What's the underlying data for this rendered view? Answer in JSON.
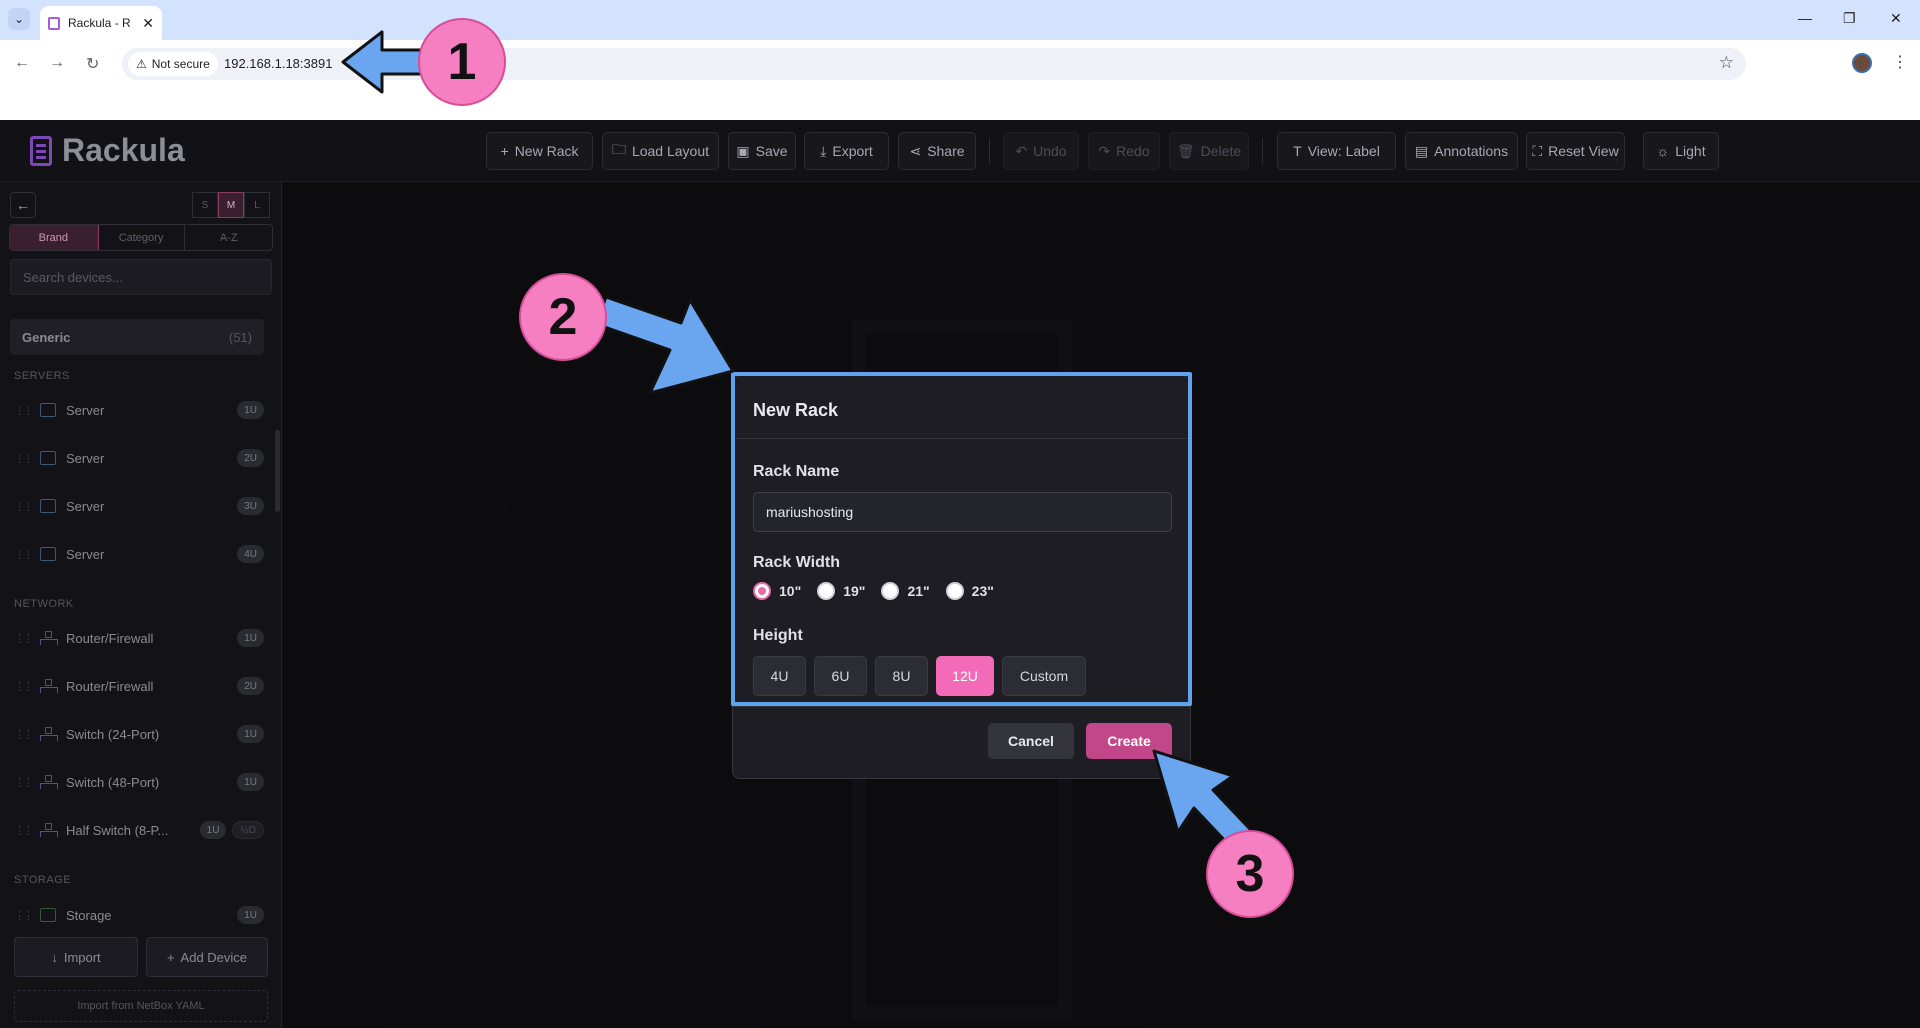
{
  "browser": {
    "tab_title": "Rackula - R",
    "security_label": "Not secure",
    "url": "192.168.1.18:3891"
  },
  "app": {
    "name": "Rackula",
    "toolbar": {
      "new_rack": "New Rack",
      "load_layout": "Load Layout",
      "save": "Save",
      "export": "Export",
      "share": "Share",
      "undo": "Undo",
      "redo": "Redo",
      "delete": "Delete",
      "view_label": "View: Label",
      "annotations": "Annotations",
      "reset_view": "Reset View",
      "light": "Light"
    }
  },
  "sidebar": {
    "sizes": [
      "S",
      "M",
      "L"
    ],
    "active_size": "M",
    "sort_tabs": [
      "Brand",
      "Category",
      "A-Z"
    ],
    "active_sort": "Brand",
    "search_placeholder": "Search devices...",
    "group": {
      "name": "Generic",
      "count": "(51)"
    },
    "categories": {
      "servers": "SERVERS",
      "network": "NETWORK",
      "storage": "STORAGE"
    },
    "devices": [
      {
        "name": "Server",
        "units": "1U",
        "kind": "server"
      },
      {
        "name": "Server",
        "units": "2U",
        "kind": "server"
      },
      {
        "name": "Server",
        "units": "3U",
        "kind": "server"
      },
      {
        "name": "Server",
        "units": "4U",
        "kind": "server"
      },
      {
        "name": "Router/Firewall",
        "units": "1U",
        "kind": "network"
      },
      {
        "name": "Router/Firewall",
        "units": "2U",
        "kind": "network"
      },
      {
        "name": "Switch (24-Port)",
        "units": "1U",
        "kind": "network"
      },
      {
        "name": "Switch (48-Port)",
        "units": "1U",
        "kind": "network"
      },
      {
        "name": "Half Switch (8-P...",
        "units": "1U",
        "extra": "½D",
        "kind": "network"
      },
      {
        "name": "Storage",
        "units": "1U",
        "kind": "storage"
      }
    ],
    "import_label": "Import",
    "add_device_label": "Add Device",
    "netbox_label": "Import from NetBox YAML"
  },
  "dialog": {
    "title": "New Rack",
    "rack_name_label": "Rack Name",
    "rack_name_value": "mariushosting",
    "rack_width_label": "Rack Width",
    "widths": [
      "10\"",
      "19\"",
      "21\"",
      "23\""
    ],
    "selected_width": "10\"",
    "height_label": "Height",
    "heights": [
      "4U",
      "6U",
      "8U",
      "12U",
      "Custom"
    ],
    "selected_height": "12U",
    "cancel_label": "Cancel",
    "create_label": "Create"
  },
  "annotations": {
    "step1": "1",
    "step2": "2",
    "step3": "3",
    "arrow_color": "#6aa6f0",
    "circle_color": "#f57fc1"
  }
}
